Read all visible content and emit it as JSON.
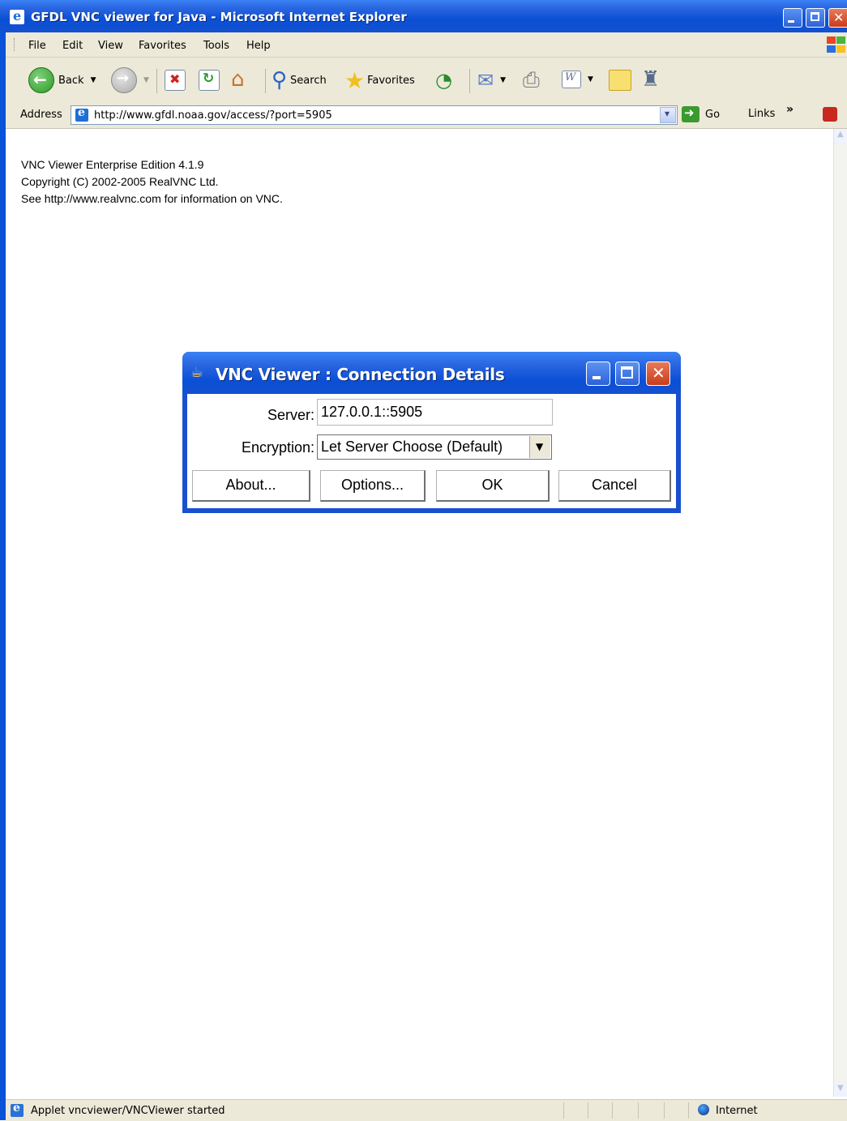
{
  "window": {
    "title": "GFDL VNC viewer for Java - Microsoft Internet Explorer"
  },
  "menu": {
    "items": [
      "File",
      "Edit",
      "View",
      "Favorites",
      "Tools",
      "Help"
    ]
  },
  "toolbar": {
    "back_label": "Back",
    "search_label": "Search",
    "favorites_label": "Favorites",
    "icons": [
      "back-icon",
      "forward-icon",
      "stop-icon",
      "refresh-icon",
      "home-icon",
      "search-icon",
      "favorites-star-icon",
      "history-icon",
      "mail-icon",
      "print-icon",
      "edit-icon",
      "discuss-icon",
      "messenger-icon"
    ]
  },
  "address": {
    "label": "Address",
    "url": "http://www.gfdl.noaa.gov/access/?port=5905",
    "go_label": "Go",
    "links_label": "Links",
    "links_chevron": "»"
  },
  "page": {
    "lines": [
      "VNC Viewer Enterprise Edition 4.1.9",
      "Copyright (C) 2002-2005 RealVNC Ltd.",
      "See http://www.realvnc.com for information on VNC."
    ]
  },
  "dialog": {
    "title": "VNC Viewer : Connection Details",
    "server_label": "Server:",
    "server_value": "127.0.0.1::5905",
    "encryption_label": "Encryption:",
    "encryption_value": "Let Server Choose (Default)",
    "about_button": "About...",
    "options_button": "Options...",
    "ok_button": "OK",
    "cancel_button": "Cancel"
  },
  "status": {
    "text": "Applet vncviewer/VNCViewer started",
    "zone": "Internet"
  },
  "colors": {
    "xp_title_blue": "#0a4fd6",
    "chrome_beige": "#ece9d8",
    "close_red": "#c93c1a"
  }
}
